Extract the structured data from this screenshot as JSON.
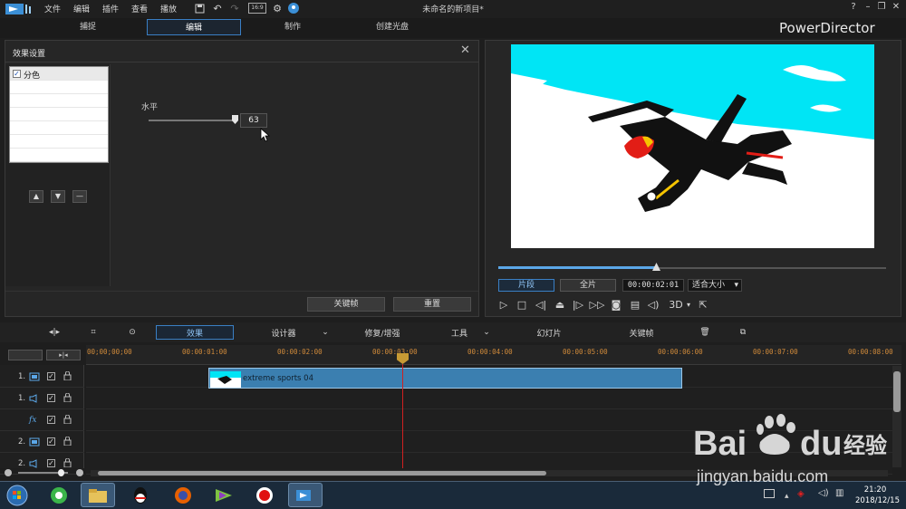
{
  "menu": {
    "file": "文件",
    "edit": "编辑",
    "plugins": "插件",
    "view": "查看",
    "play": "播放"
  },
  "window": {
    "title": "未命名的新项目*",
    "aspect": "16:9",
    "help": "?"
  },
  "tabs": {
    "capture": "捕捉",
    "edit": "编辑",
    "produce": "制作",
    "disc": "创建光盘"
  },
  "brand": "PowerDirector",
  "effect_panel": {
    "title": "效果设置",
    "effect_item": "分色",
    "level_label": "水平",
    "level_value": "63",
    "level_fraction": 0.95,
    "keyframe": "关键帧",
    "reset": "重置"
  },
  "preview": {
    "clip_mode": "片段",
    "movie_mode": "全片",
    "timecode": "00:00:02:01",
    "fit": "适合大小",
    "threed": "3D",
    "progress_fraction": 0.41
  },
  "toolbar": {
    "effect": "效果",
    "designer": "设计器",
    "fix": "修复/增强",
    "tools": "工具",
    "slideshow": "幻灯片",
    "keyframe": "关键帧"
  },
  "ruler": {
    "ticks": [
      "00;00;00;00",
      "00:00:01:00",
      "00:00:02:00",
      "00:00:03:00",
      "00:00:04:00",
      "00:00:05:00",
      "00:00:06:00",
      "00:00:07:00",
      "00:00:08:00"
    ]
  },
  "tracks": [
    {
      "num": "1.",
      "type": "video"
    },
    {
      "num": "1.",
      "type": "audio"
    },
    {
      "num": "",
      "type": "fx"
    },
    {
      "num": "2.",
      "type": "video"
    },
    {
      "num": "2.",
      "type": "audio"
    }
  ],
  "clip": {
    "name": "extreme sports 04"
  },
  "taskbar": {
    "time": "21:20",
    "date": "2018/12/15"
  },
  "watermark": {
    "brand": "Bai",
    "brand2": "du",
    "cn": "经验",
    "url": "jingyan.baidu.com"
  }
}
